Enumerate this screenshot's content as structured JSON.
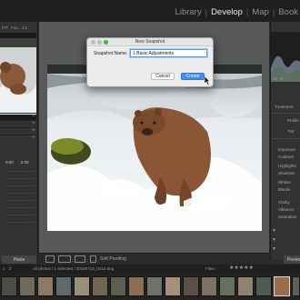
{
  "modules": {
    "items": [
      {
        "label": "Library",
        "active": false
      },
      {
        "label": "Develop",
        "active": true
      },
      {
        "label": "Map",
        "active": false
      },
      {
        "label": "Book",
        "active": false
      }
    ],
    "separator": "|"
  },
  "left_panel": {
    "navigator_head": [
      "FIT",
      "FILL",
      "1:1"
    ],
    "readout": {
      "left": "0.00",
      "right": "0.00"
    },
    "bottom_button": "Paste"
  },
  "dialog": {
    "title": "New Snapshot",
    "field_label": "Snapshot Name:",
    "field_value": "1 Basic Adjustments",
    "cancel_label": "Cancel",
    "create_label": "Create"
  },
  "right_panel": {
    "treatment_label": "Treatment",
    "profile_labels": [
      "Profile",
      "Tint"
    ],
    "tone_labels": [
      "Exposure",
      "Contrast",
      "Highlights",
      "Shadows",
      "Whites",
      "Blacks",
      "Clarity",
      "Vibrance",
      "Saturation"
    ],
    "bottom_button": "Previous"
  },
  "toolbar": {
    "soft_proofing_label": "Soft Proofing"
  },
  "filmstrip": {
    "page_nums": [
      "1",
      "2"
    ],
    "status": "All photos / 1 selected / 20180714_0415.dng",
    "filter_label": "Filter :"
  },
  "colors": {
    "accent": "#3d8ff5",
    "panel": "#323232",
    "background": "#595959"
  }
}
